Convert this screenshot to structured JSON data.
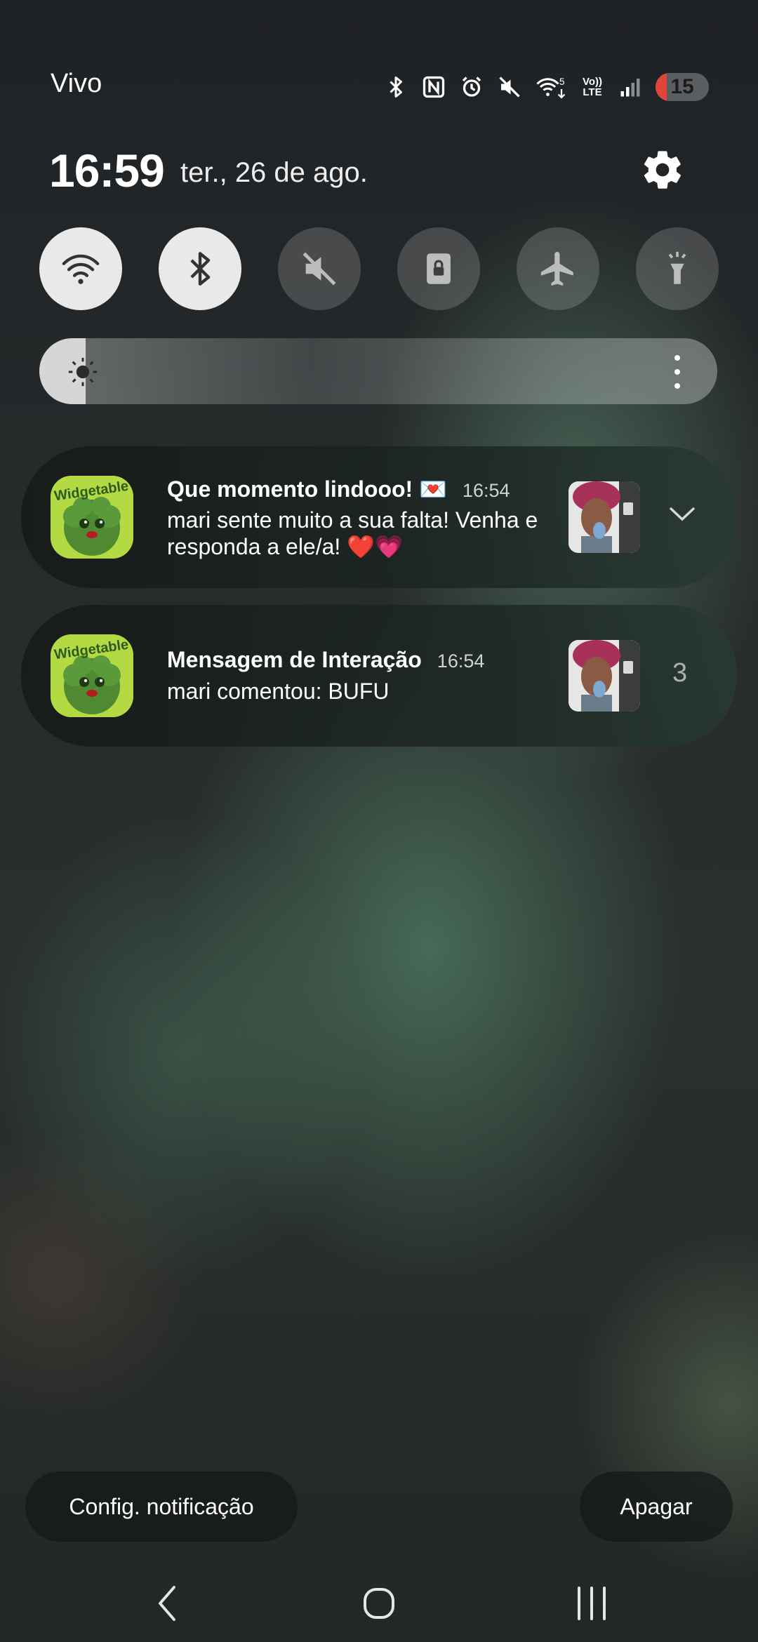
{
  "status_bar": {
    "carrier": "Vivo",
    "icons": [
      "bluetooth-icon",
      "nfc-icon",
      "alarm-icon",
      "mute-icon",
      "wifi-icon",
      "volte-icon",
      "signal-icon"
    ],
    "volte_top": "Vo))",
    "volte_bottom": "LTE",
    "wifi_generation": "5",
    "battery_level": "15",
    "battery_color": "#e0453a"
  },
  "header": {
    "time": "16:59",
    "date": "ter., 26 de ago."
  },
  "quick_settings": [
    {
      "name": "wifi",
      "icon": "wifi-icon",
      "state": "on"
    },
    {
      "name": "bluetooth",
      "icon": "bluetooth-icon",
      "state": "on"
    },
    {
      "name": "sound",
      "icon": "mute-icon",
      "state": "off"
    },
    {
      "name": "rotation-lock",
      "icon": "lock-icon",
      "state": "off"
    },
    {
      "name": "airplane-mode",
      "icon": "airplane-icon",
      "state": "off"
    },
    {
      "name": "flashlight",
      "icon": "flashlight-icon",
      "state": "off"
    }
  ],
  "brightness": {
    "level": 0.03
  },
  "notifications": [
    {
      "app_icon": "widgetable-app-icon",
      "app_icon_text": "Widgetable",
      "title": "Que momento lindooo! 💌",
      "time": "16:54",
      "body": "mari sente muito a sua falta! Venha e responda a ele/a! ❤️💗",
      "action_icon": "chevron-down-icon"
    },
    {
      "app_icon": "widgetable-app-icon",
      "app_icon_text": "Widgetable",
      "title": "Mensagem de Interação",
      "time": "16:54",
      "body": "mari comentou: BUFU",
      "count": "3"
    }
  ],
  "footer": {
    "settings_label": "Config. notificação",
    "clear_label": "Apagar"
  },
  "nav_bar": {
    "back_icon": "back-icon",
    "home_icon": "home-icon",
    "recents_icon": "recents-icon"
  }
}
